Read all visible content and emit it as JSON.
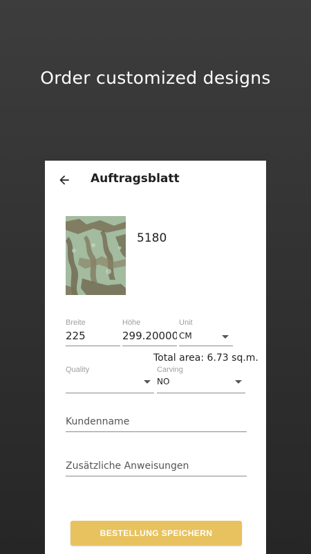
{
  "promo": {
    "headline": "Order customized designs"
  },
  "appbar": {
    "title": "Auftragsblatt",
    "back_icon": "arrow-left-icon"
  },
  "design": {
    "number": "5180"
  },
  "dimensions": {
    "width_label": "Breite",
    "width_value": "225",
    "height_label": "Höhe",
    "height_value": "299.2000000",
    "unit_label": "Unit",
    "unit_value": "CM"
  },
  "total_area": "Total area: 6.73 sq.m.",
  "options": {
    "quality_label": "Quality",
    "quality_value": "",
    "carving_label": "Carving",
    "carving_value": "NO"
  },
  "inputs": {
    "customer_placeholder": "Kundenname",
    "instructions_placeholder": "Zusätzliche Anweisungen"
  },
  "actions": {
    "save_label": "BESTELLUNG SPEICHERN"
  },
  "colors": {
    "accent": "#e8c25e",
    "background": "#2f2f2f"
  }
}
